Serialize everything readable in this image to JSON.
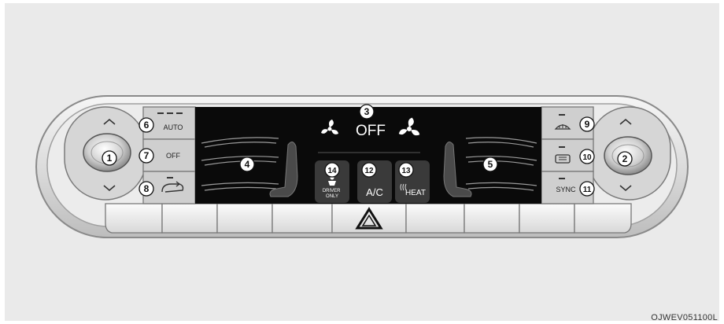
{
  "figure_code": "OJWEV051100L",
  "display": {
    "status_text": "OFF"
  },
  "buttons": {
    "auto": "AUTO",
    "off": "OFF",
    "sync": "SYNC",
    "ac": "A/C",
    "heat": "HEAT",
    "driver_only": "DRIVER\nONLY"
  },
  "callouts": [
    "1",
    "2",
    "3",
    "4",
    "5",
    "6",
    "7",
    "8",
    "9",
    "10",
    "11",
    "12",
    "13",
    "14"
  ]
}
